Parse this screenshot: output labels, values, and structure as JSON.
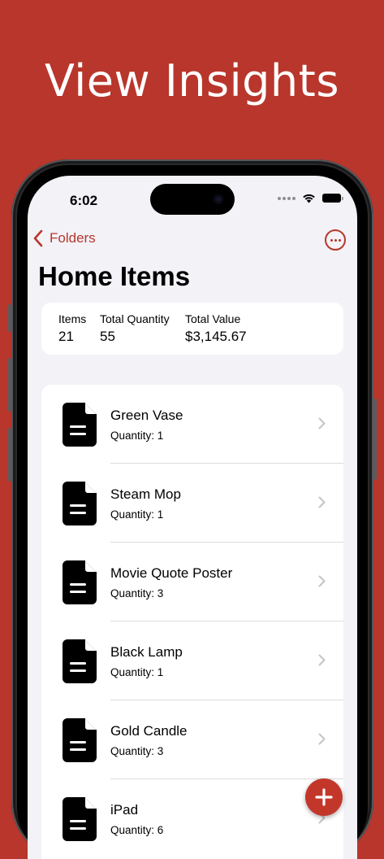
{
  "headline": "View Insights",
  "status_bar": {
    "time": "6:02"
  },
  "nav": {
    "back_label": "Folders"
  },
  "page_title": "Home Items",
  "summary": {
    "items_label": "Items",
    "items_value": "21",
    "quantity_label": "Total Quantity",
    "quantity_value": "55",
    "value_label": "Total Value",
    "value_value": "$3,145.67"
  },
  "items": [
    {
      "name": "Green Vase",
      "quantity": "Quantity: 1"
    },
    {
      "name": "Steam Mop",
      "quantity": "Quantity: 1"
    },
    {
      "name": "Movie Quote Poster",
      "quantity": "Quantity: 3"
    },
    {
      "name": "Black Lamp",
      "quantity": "Quantity: 1"
    },
    {
      "name": "Gold Candle",
      "quantity": "Quantity: 3"
    },
    {
      "name": "iPad",
      "quantity": "Quantity: 6"
    }
  ],
  "colors": {
    "brand": "#b8362b",
    "background": "#f2f2f7"
  },
  "icons": {
    "back": "chevron-left-icon",
    "more": "ellipsis-circle-icon",
    "item": "document-icon",
    "row_chevron": "chevron-right-icon",
    "add": "plus-icon"
  }
}
